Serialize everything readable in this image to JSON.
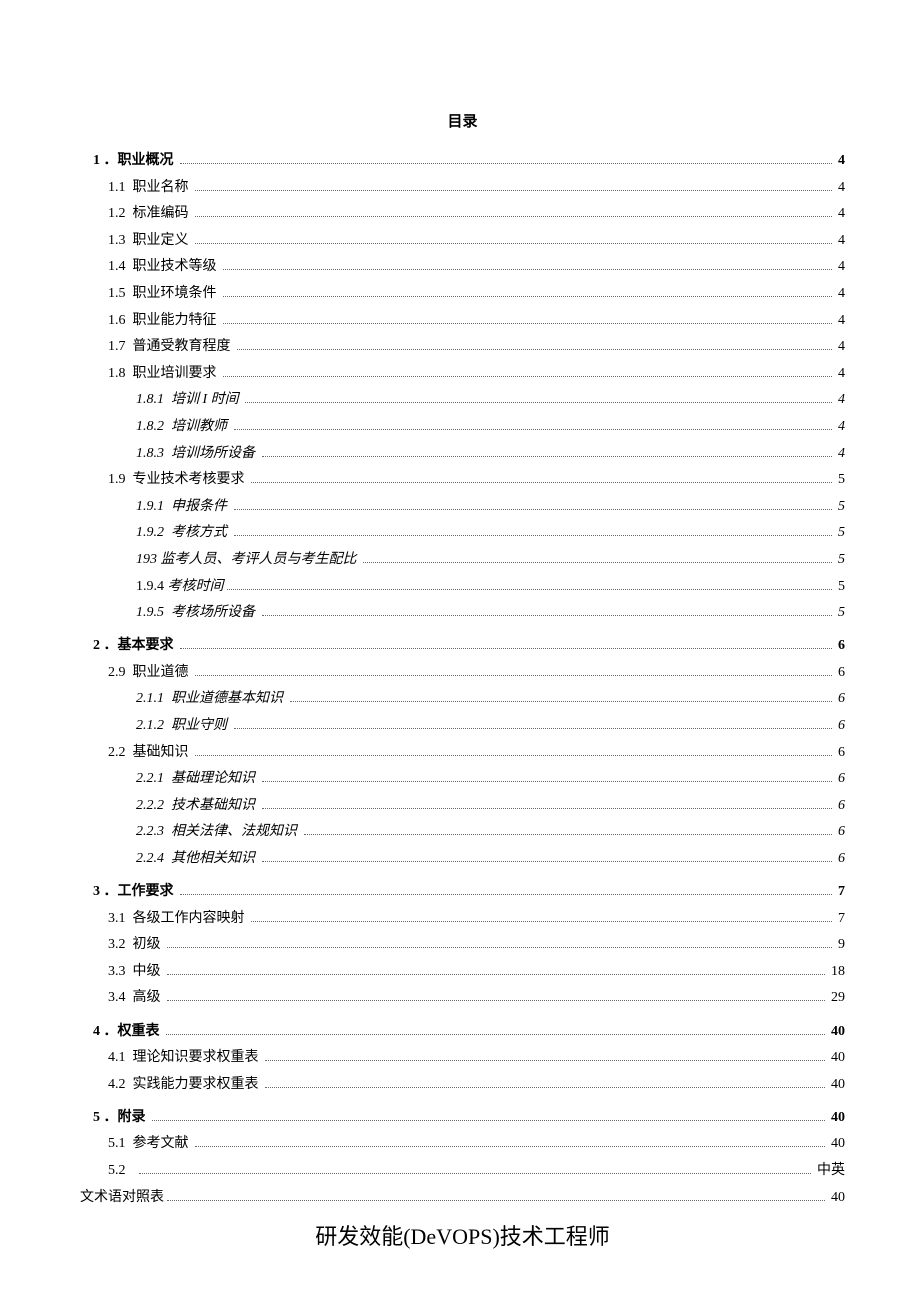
{
  "title": "目录",
  "footer": "研发效能(DeVOPS)技术工程师",
  "sections": [
    {
      "num": "1",
      "label": "．职业概况",
      "page": "4",
      "bold": true,
      "indent": 0,
      "children": [
        {
          "num": "1.1",
          "label": "职业名称",
          "page": "4",
          "indent": 1
        },
        {
          "num": "1.2",
          "label": "标准编码",
          "page": "4",
          "indent": 1
        },
        {
          "num": "1.3",
          "label": "职业定义",
          "page": "4",
          "indent": 1
        },
        {
          "num": "1.4",
          "label": "职业技术等级",
          "page": "4",
          "indent": 1
        },
        {
          "num": "1.5",
          "label": "职业环境条件",
          "page": "4",
          "indent": 1
        },
        {
          "num": "1.6",
          "label": "职业能力特征",
          "page": "4",
          "indent": 1
        },
        {
          "num": "1.7",
          "label": "普通受教育程度",
          "page": "4",
          "indent": 1
        },
        {
          "num": "1.8",
          "label": "职业培训要求",
          "page": "4",
          "indent": 1
        },
        {
          "num": "1.8.1",
          "label": "培训 I 时间",
          "page": "4",
          "indent": 2,
          "italic": true
        },
        {
          "num": "1.8.2",
          "label": "培训教师",
          "page": "4",
          "indent": 2,
          "italic": true
        },
        {
          "num": "1.8.3",
          "label": "培训场所设备",
          "page": "4",
          "indent": 2,
          "italic": true
        },
        {
          "num": "1.9",
          "label": "专业技术考核要求",
          "page": "5",
          "indent": 1
        },
        {
          "num": "1.9.1",
          "label": "申报条件",
          "page": "5",
          "indent": 2,
          "italic": true
        },
        {
          "num": "1.9.2",
          "label": "考核方式",
          "page": "5",
          "indent": 2,
          "italic": true
        },
        {
          "num": "193",
          "label": "监考人员、考评人员与考生配比",
          "page": "5",
          "indent": 2,
          "italic": true,
          "numSpace": " "
        },
        {
          "num": "1.9.4",
          "label": " 考核时间",
          "page": "5",
          "indent": 2,
          "italic": false,
          "mixed": true
        },
        {
          "num": "1.9.5",
          "label": "考核场所设备",
          "page": "5",
          "indent": 2,
          "italic": true
        }
      ]
    },
    {
      "num": "2",
      "label": "．基本要求",
      "page": "6",
      "bold": true,
      "indent": 0,
      "children": [
        {
          "num": "2.9",
          "label": "职业道德",
          "page": "6",
          "indent": 1
        },
        {
          "num": "2.1.1",
          "label": "职业道德基本知识",
          "page": "6",
          "indent": 2,
          "italic": true
        },
        {
          "num": "2.1.2",
          "label": "职业守则",
          "page": "6",
          "indent": 2,
          "italic": true
        },
        {
          "num": "2.2",
          "label": "基础知识",
          "page": "6",
          "indent": 1
        },
        {
          "num": "2.2.1",
          "label": "基础理论知识",
          "page": "6",
          "indent": 2,
          "italic": true
        },
        {
          "num": "2.2.2",
          "label": "技术基础知识",
          "page": "6",
          "indent": 2,
          "italic": true
        },
        {
          "num": "2.2.3",
          "label": "相关法律、法规知识",
          "page": "6",
          "indent": 2,
          "italic": true
        },
        {
          "num": "2.2.4",
          "label": "其他相关知识",
          "page": "6",
          "indent": 2,
          "italic": true
        }
      ]
    },
    {
      "num": "3",
      "label": "．工作要求",
      "page": "7",
      "bold": true,
      "indent": 0,
      "children": [
        {
          "num": "3.1",
          "label": "各级工作内容映射",
          "page": "7",
          "indent": 1
        },
        {
          "num": "3.2",
          "label": "初级",
          "page": "9",
          "indent": 1
        },
        {
          "num": "3.3",
          "label": "中级",
          "page": "18",
          "indent": 1
        },
        {
          "num": "3.4",
          "label": "高级",
          "page": "29",
          "indent": 1
        }
      ]
    },
    {
      "num": "4",
      "label": "．权重表",
      "page": "40",
      "bold": true,
      "indent": 0,
      "children": [
        {
          "num": "4.1",
          "label": "理论知识要求权重表",
          "page": "40",
          "indent": 1
        },
        {
          "num": "4.2",
          "label": "实践能力要求权重表",
          "page": "40",
          "indent": 1
        }
      ]
    },
    {
      "num": "5",
      "label": "．附录",
      "page": "40",
      "bold": true,
      "indent": 0,
      "children": [
        {
          "num": "5.1",
          "label": "参考文献",
          "page": "40",
          "indent": 1
        },
        {
          "num": "5.2",
          "label": "",
          "page": "中英",
          "indent": 1,
          "special52": true
        },
        {
          "num": "",
          "label": "文术语对照表",
          "page": "40",
          "indent": 1,
          "continuation": true
        }
      ]
    }
  ]
}
